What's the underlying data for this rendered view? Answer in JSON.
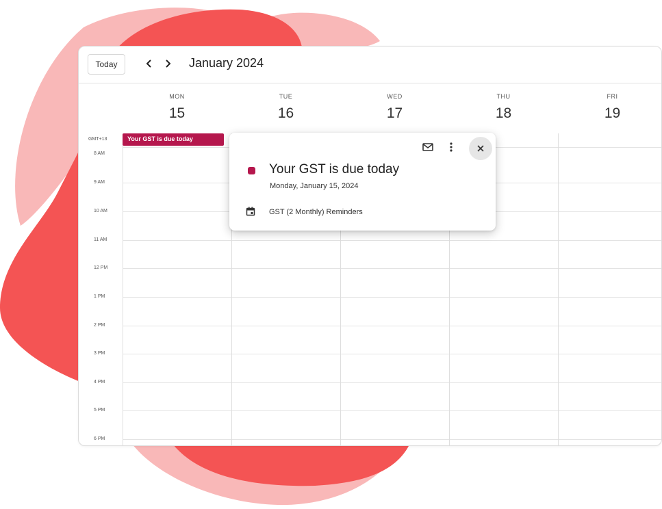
{
  "colors": {
    "event": "#b5174d",
    "blob_red": "#f45454",
    "blob_pink": "#f9b8b8"
  },
  "toolbar": {
    "today_label": "Today",
    "prev_icon": "chevron-left-icon",
    "next_icon": "chevron-right-icon",
    "month_title": "January 2024"
  },
  "days": [
    {
      "name": "MON",
      "num": "15"
    },
    {
      "name": "TUE",
      "num": "16"
    },
    {
      "name": "WED",
      "num": "17"
    },
    {
      "name": "THU",
      "num": "18"
    },
    {
      "name": "FRI",
      "num": "19"
    }
  ],
  "timezone": "GMT+13",
  "allday_event": "Your GST is due today",
  "hours": [
    "8 AM",
    "9 AM",
    "10 AM",
    "11 AM",
    "12 PM",
    "1 PM",
    "2 PM",
    "3 PM",
    "4 PM",
    "5 PM",
    "6 PM"
  ],
  "popup": {
    "title": "Your GST is due today",
    "date": "Monday, January 15, 2024",
    "calendar_name": "GST (2 Monthly) Reminders",
    "icons": [
      "mail-icon",
      "more-vertical-icon",
      "close-icon",
      "calendar-icon"
    ]
  }
}
